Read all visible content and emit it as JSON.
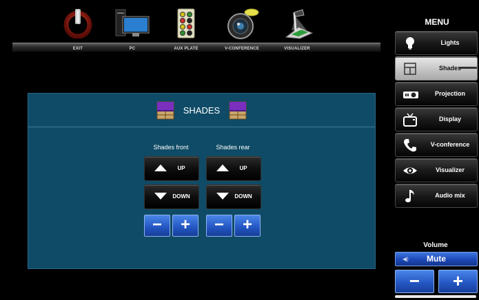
{
  "sources": [
    {
      "label": "EXIT",
      "icon": "power-icon"
    },
    {
      "label": "PC",
      "icon": "pc-icon"
    },
    {
      "label": "AUX PLATE",
      "icon": "aux-plate-icon"
    },
    {
      "label": "V-CONFERENCE",
      "icon": "camera-icon"
    },
    {
      "label": "VISUALIZER",
      "icon": "visualizer-icon"
    }
  ],
  "menu": {
    "title": "MENU",
    "items": [
      {
        "label": "Lights",
        "icon": "bulb-icon"
      },
      {
        "label": "Shades",
        "icon": "shade-window-icon",
        "active": true
      },
      {
        "label": "Projection",
        "icon": "projector-icon"
      },
      {
        "label": "Display",
        "icon": "tv-icon"
      },
      {
        "label": "V-conference",
        "icon": "phone-icon"
      },
      {
        "label": "Visualizer",
        "icon": "eye-icon"
      },
      {
        "label": "Audio mix",
        "icon": "music-note-icon"
      }
    ]
  },
  "panel": {
    "title": "SHADES",
    "groups": [
      {
        "label": "Shades front",
        "up": "UP",
        "down": "DOWN",
        "minus": "−",
        "plus": "+"
      },
      {
        "label": "Shades rear",
        "up": "UP",
        "down": "DOWN",
        "minus": "−",
        "plus": "+"
      }
    ]
  },
  "volume": {
    "title": "Volume",
    "mute": "Mute",
    "minus": "−",
    "plus": "+"
  },
  "colors": {
    "panel_bg": "#0f4b66",
    "accent_blue": "#2558c4",
    "shade_purple": "#7b2fbf"
  }
}
